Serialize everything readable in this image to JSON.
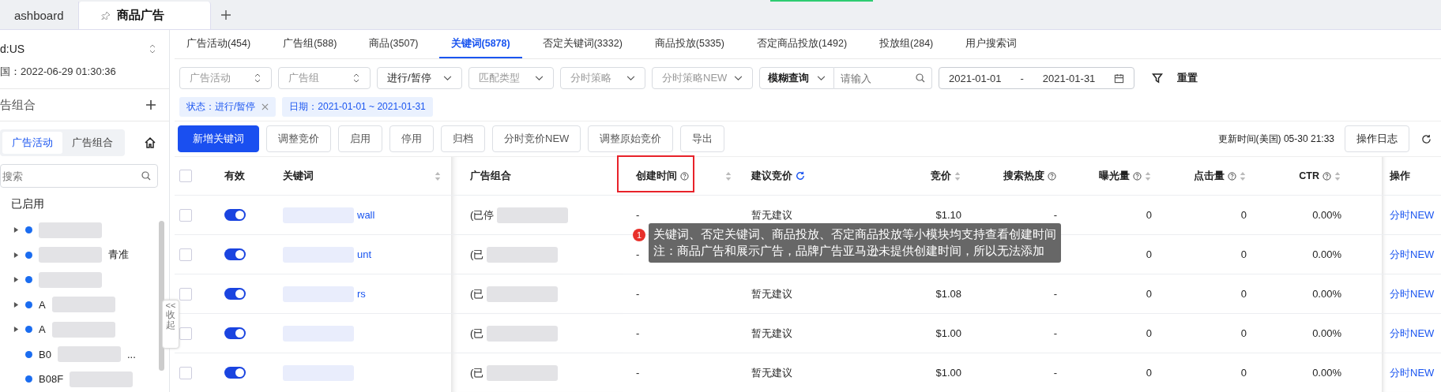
{
  "window_tabs": [
    {
      "label": "ashboard",
      "selected": false,
      "pinned": false
    },
    {
      "label": "商品广告",
      "selected": true,
      "pinned": true
    }
  ],
  "sidebar": {
    "store": "d:US",
    "time": "国：2022-06-29 01:30:36",
    "section_title": "告组合",
    "segments": [
      {
        "label": "广告活动",
        "selected": true
      },
      {
        "label": "广告组合",
        "selected": false
      }
    ],
    "search": {
      "placeholder": "搜索"
    },
    "group_title": "已启用",
    "items": [
      {
        "kind": "group",
        "expanded": false
      },
      {
        "kind": "group",
        "expanded": false,
        "suffix": "青准"
      },
      {
        "kind": "group",
        "expanded": false
      },
      {
        "kind": "group",
        "expanded": false,
        "prefix": "A"
      },
      {
        "kind": "group",
        "expanded": false,
        "prefix": "A"
      },
      {
        "kind": "leaf",
        "prefix": "B0",
        "suffix": "..."
      },
      {
        "kind": "leaf",
        "prefix": "B08F"
      }
    ],
    "collapse": {
      "arrow": "<<",
      "label": "收起"
    }
  },
  "tabs": [
    {
      "label": "广告活动(454)",
      "selected": false
    },
    {
      "label": "广告组(588)",
      "selected": false
    },
    {
      "label": "商品(3507)",
      "selected": false
    },
    {
      "label": "关键词(5878)",
      "selected": true
    },
    {
      "label": "否定关键词(3332)",
      "selected": false
    },
    {
      "label": "商品投放(5335)",
      "selected": false
    },
    {
      "label": "否定商品投放(1492)",
      "selected": false
    },
    {
      "label": "投放组(284)",
      "selected": false
    },
    {
      "label": "用户搜索词",
      "selected": false
    }
  ],
  "filters": [
    {
      "kind": "spinner",
      "placeholder": "广告活动"
    },
    {
      "kind": "spinner",
      "placeholder": "广告组"
    },
    {
      "kind": "select",
      "value": "进行/暂停"
    },
    {
      "kind": "select",
      "placeholder": "匹配类型"
    },
    {
      "kind": "select",
      "placeholder": "分时策略"
    },
    {
      "kind": "select",
      "placeholder": "分时策略NEW"
    }
  ],
  "query": {
    "mode": "模糊查询",
    "placeholder": "请输入"
  },
  "date_range": {
    "start": "2021-01-01",
    "separator": "-",
    "end": "2021-01-31"
  },
  "reset": "重置",
  "tags": [
    "状态：进行/暂停",
    "日期：2021-01-01 ~ 2021-01-31"
  ],
  "actions": [
    {
      "label": "新增关键词",
      "primary": true
    },
    {
      "label": "调整竞价",
      "primary": false
    },
    {
      "label": "启用",
      "primary": false
    },
    {
      "label": "停用",
      "primary": false
    },
    {
      "label": "归档",
      "primary": false
    },
    {
      "label": "分时竞价NEW",
      "primary": false
    },
    {
      "label": "调整原始竞价",
      "primary": false
    },
    {
      "label": "导出",
      "primary": false
    }
  ],
  "update_time": "更新时间(美国) 05-30 21:33",
  "log_button": "操作日志",
  "table": {
    "all_checked": false,
    "columns": [
      {
        "label": "有效",
        "sortable": false,
        "help": false
      },
      {
        "label": "关键词",
        "sortable": true,
        "help": false
      },
      {
        "label": "广告组合",
        "sortable": false,
        "help": false
      },
      {
        "label": "创建时间",
        "sortable": true,
        "help": true
      },
      {
        "label": "建议竞价",
        "sortable": false,
        "help": false,
        "refresh": true
      },
      {
        "label": "竞价",
        "sortable": true,
        "help": false
      },
      {
        "label": "搜索热度",
        "sortable": false,
        "help": true
      },
      {
        "label": "曝光量",
        "sortable": true,
        "help": true
      },
      {
        "label": "点击量",
        "sortable": true,
        "help": true
      },
      {
        "label": "CTR",
        "sortable": true,
        "help": true
      },
      {
        "label": "操作",
        "sortable": false,
        "help": false
      }
    ],
    "rows": [
      {
        "checked": false,
        "on": true,
        "keyword": "wall",
        "ad_group": "(已停",
        "created": "-",
        "suggested": "暂无建议",
        "bid": "$1.10",
        "heat": "-",
        "impressions": "0",
        "clicks": "0",
        "ctr": "0.00%",
        "action": "分时NEW"
      },
      {
        "checked": false,
        "on": true,
        "keyword": "unt",
        "ad_group": "(已",
        "created": "-",
        "impressions": "0",
        "clicks": "0",
        "ctr": "0.00%",
        "action": "分时NEW"
      },
      {
        "checked": false,
        "on": true,
        "keyword": "rs",
        "ad_group": "(已",
        "created": "-",
        "suggested": "暂无建议",
        "bid": "$1.08",
        "heat": "-",
        "impressions": "0",
        "clicks": "0",
        "ctr": "0.00%",
        "action": "分时NEW"
      },
      {
        "checked": false,
        "on": true,
        "ad_group": "(已",
        "created": "-",
        "suggested": "暂无建议",
        "bid": "$1.00",
        "heat": "-",
        "impressions": "0",
        "clicks": "0",
        "ctr": "0.00%",
        "action": "分时NEW"
      },
      {
        "checked": false,
        "on": true,
        "ad_group": "(已",
        "created": "-",
        "suggested": "暂无建议",
        "bid": "$1.00",
        "heat": "-",
        "impressions": "0",
        "clicks": "0",
        "ctr": "0.00%",
        "action": "分时NEW"
      }
    ]
  },
  "annotation": {
    "number": "1",
    "lines": [
      "关键词、否定关键词、商品投放、否定商品投放等小模块均支持查看创建时间",
      "注：商品广告和展示广告，品牌广告亚马逊未提供创建时间，所以无法添加"
    ]
  }
}
